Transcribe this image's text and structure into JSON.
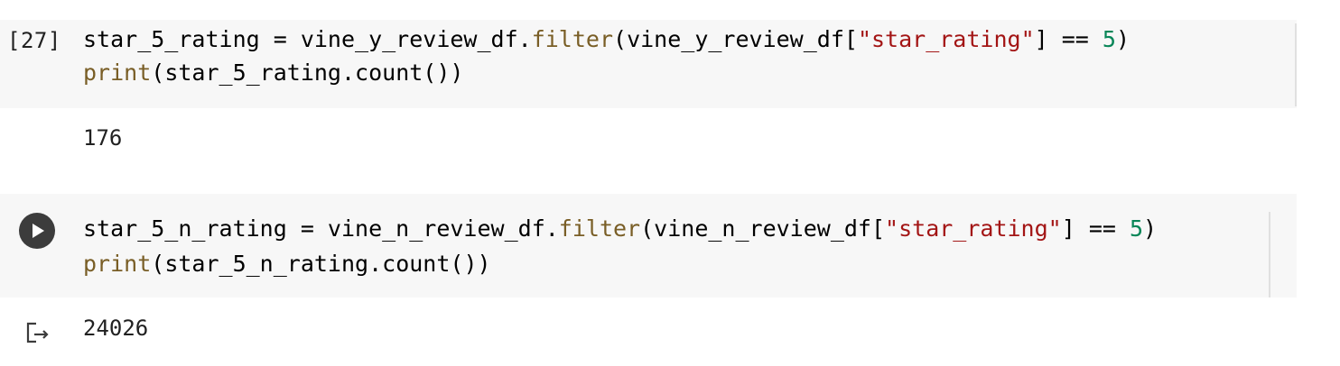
{
  "cell1": {
    "execution_count": "[27]",
    "code_line1": [
      {
        "cls": "tok-plain",
        "text": "star_5_rating = vine_y_review_df."
      },
      {
        "cls": "tok-fn",
        "text": "filter"
      },
      {
        "cls": "tok-plain",
        "text": "(vine_y_review_df["
      },
      {
        "cls": "tok-str",
        "text": "\"star_rating\""
      },
      {
        "cls": "tok-plain",
        "text": "] == "
      },
      {
        "cls": "tok-num",
        "text": "5"
      },
      {
        "cls": "tok-plain",
        "text": ")"
      }
    ],
    "code_line2": [
      {
        "cls": "tok-fn",
        "text": "print"
      },
      {
        "cls": "tok-plain",
        "text": "(star_5_rating.count())"
      }
    ],
    "output": "176"
  },
  "cell2": {
    "code_line1": [
      {
        "cls": "tok-plain",
        "text": "star_5_n_rating = vine_n_review_df."
      },
      {
        "cls": "tok-fn",
        "text": "filter"
      },
      {
        "cls": "tok-plain",
        "text": "(vine_n_review_df["
      },
      {
        "cls": "tok-str",
        "text": "\"star_rating\""
      },
      {
        "cls": "tok-plain",
        "text": "] == "
      },
      {
        "cls": "tok-num",
        "text": "5"
      },
      {
        "cls": "tok-plain",
        "text": ")"
      }
    ],
    "code_line2": [
      {
        "cls": "tok-fn",
        "text": "print"
      },
      {
        "cls": "tok-plain",
        "text": "(star_5_n_rating.count())"
      }
    ],
    "output": "24026"
  },
  "icons": {
    "run": "play-icon",
    "output": "output-redirect-icon"
  },
  "colors": {
    "cell_background": "#f7f7f7",
    "function": "#795e26",
    "string": "#a31515",
    "number": "#098658",
    "run_button": "#3c3c3c"
  }
}
